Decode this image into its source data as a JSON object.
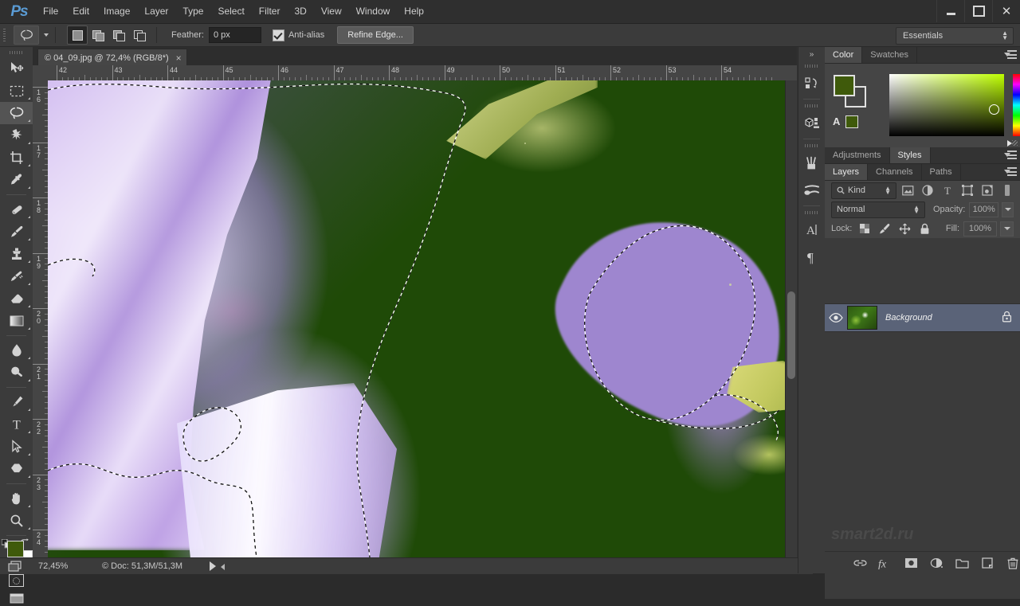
{
  "app": {
    "name": "Ps",
    "logo_color": "#5a9bd4"
  },
  "titlebar": {
    "menus": [
      "File",
      "Edit",
      "Image",
      "Layer",
      "Type",
      "Select",
      "Filter",
      "3D",
      "View",
      "Window",
      "Help"
    ],
    "window_buttons": [
      "minimize-button",
      "maximize-button",
      "close-button"
    ]
  },
  "options_bar": {
    "tool": "lasso-tool",
    "selection_modes": [
      "new-selection",
      "add-to-selection",
      "subtract-from-selection",
      "intersect-with-selection"
    ],
    "active_selection_mode": 0,
    "feather_label": "Feather:",
    "feather_value": "0 px",
    "antialias_label": "Anti-alias",
    "antialias_checked": true,
    "refine_edge_label": "Refine Edge...",
    "workspace": "Essentials"
  },
  "toolbar": {
    "tools": [
      {
        "name": "move-tool",
        "active": false
      },
      {
        "name": "rectangular-marquee-tool",
        "active": false
      },
      {
        "name": "lasso-tool",
        "active": true
      },
      {
        "name": "magic-wand-tool",
        "active": false
      },
      {
        "name": "crop-tool",
        "active": false
      },
      {
        "name": "eyedropper-tool",
        "active": false
      },
      {
        "name": "spot-healing-brush-tool",
        "active": false
      },
      {
        "name": "brush-tool",
        "active": false
      },
      {
        "name": "clone-stamp-tool",
        "active": false
      },
      {
        "name": "history-brush-tool",
        "active": false
      },
      {
        "name": "eraser-tool",
        "active": false
      },
      {
        "name": "gradient-tool",
        "active": false
      },
      {
        "name": "blur-tool",
        "active": false
      },
      {
        "name": "dodge-tool",
        "active": false
      },
      {
        "name": "pen-tool",
        "active": false
      },
      {
        "name": "type-tool",
        "active": false
      },
      {
        "name": "path-selection-tool",
        "active": false
      },
      {
        "name": "shape-tool",
        "active": false
      },
      {
        "name": "hand-tool",
        "active": false
      },
      {
        "name": "zoom-tool",
        "active": false
      }
    ],
    "foreground_color": "#3f5a0b",
    "background_color": "#ffffff"
  },
  "document": {
    "tab_title": "04_09.jpg @ 72,4% (RGB/8*)",
    "close_label": "×",
    "ruler_h_labels": [
      "42",
      "43",
      "44",
      "45",
      "46",
      "47",
      "48",
      "49",
      "50",
      "51",
      "52",
      "53",
      "54"
    ],
    "ruler_v_labels": [
      "16",
      "17",
      "18",
      "19",
      "20",
      "21",
      "22",
      "23",
      "24"
    ]
  },
  "statusbar": {
    "zoom": "72,45%",
    "doc_info": "© Doc: 51,3M/51,3M"
  },
  "dock_rail": {
    "items": [
      "history-icon",
      "3d-icon",
      "brush-icon",
      "brush-presets-icon",
      "character-icon",
      "paragraph-icon"
    ],
    "collapse_label": "»"
  },
  "color_panel": {
    "tabs": [
      {
        "label": "Color",
        "active": true
      },
      {
        "label": "Swatches",
        "active": false
      }
    ],
    "foreground_color": "#3f5a0b",
    "gamut_warning": "A"
  },
  "adjustments_panel": {
    "tabs": [
      {
        "label": "Adjustments",
        "active": false
      },
      {
        "label": "Styles",
        "active": true
      }
    ]
  },
  "layers_panel": {
    "tabs": [
      {
        "label": "Layers",
        "active": true
      },
      {
        "label": "Channels",
        "active": false
      },
      {
        "label": "Paths",
        "active": false
      }
    ],
    "filter_kind": "Kind",
    "filter_icons": [
      "pixel-filter-icon",
      "adjustment-filter-icon",
      "type-filter-icon",
      "shape-filter-icon",
      "smart-object-filter-icon"
    ],
    "blend_mode": "Normal",
    "opacity_label": "Opacity:",
    "opacity_value": "100%",
    "lock_label": "Lock:",
    "lock_icons": [
      "lock-transparent-pixels-icon",
      "lock-image-pixels-icon",
      "lock-position-icon",
      "lock-all-icon"
    ],
    "fill_label": "Fill:",
    "fill_value": "100%",
    "layers": [
      {
        "name": "Background",
        "visible": true,
        "locked": true,
        "selected": true
      }
    ],
    "footer_icons": [
      "link-layers-icon",
      "layer-style-fx-icon",
      "add-layer-mask-icon",
      "new-adjustment-layer-icon",
      "new-group-icon",
      "new-layer-icon",
      "delete-layer-icon"
    ]
  },
  "watermark": {
    "text": "smart2d.ru"
  }
}
